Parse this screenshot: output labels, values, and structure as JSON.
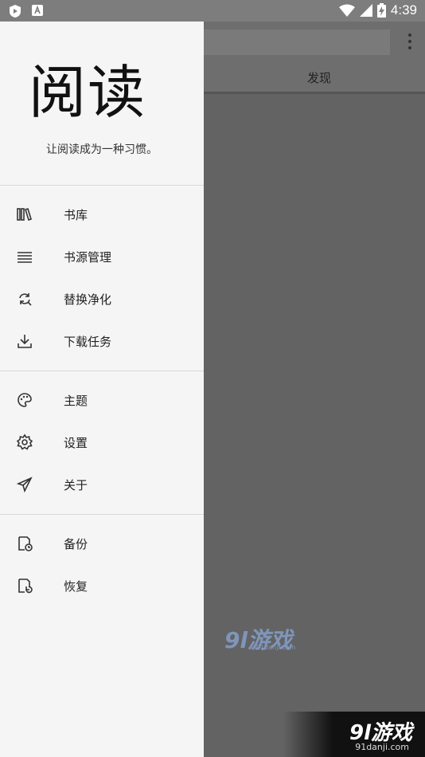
{
  "status_bar": {
    "time": "4:39"
  },
  "app_bar": {
    "tab_label": "发现"
  },
  "drawer": {
    "logo": "阅读",
    "slogan": "让阅读成为一种习惯。",
    "groups": [
      [
        {
          "label": "书库",
          "icon": "bookshelf-icon"
        },
        {
          "label": "书源管理",
          "icon": "list-icon"
        },
        {
          "label": "替换净化",
          "icon": "replace-icon"
        },
        {
          "label": "下载任务",
          "icon": "download-icon"
        }
      ],
      [
        {
          "label": "主题",
          "icon": "palette-icon"
        },
        {
          "label": "设置",
          "icon": "gear-icon"
        },
        {
          "label": "关于",
          "icon": "send-icon"
        }
      ],
      [
        {
          "label": "备份",
          "icon": "backup-icon"
        },
        {
          "label": "恢复",
          "icon": "restore-icon"
        }
      ]
    ]
  },
  "watermark": {
    "logo": "9l游戏",
    "url": "91danji.com"
  }
}
